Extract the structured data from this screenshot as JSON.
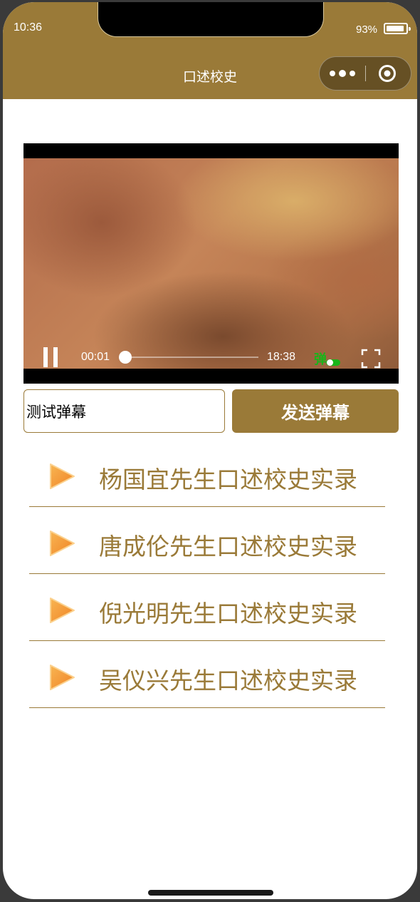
{
  "status_bar": {
    "time": "10:36",
    "battery_percent": "93%"
  },
  "nav": {
    "title": "口述校史",
    "capsule_icons": [
      "more-icon",
      "target-icon"
    ]
  },
  "video": {
    "current_time": "00:01",
    "total_time": "18:38",
    "progress": 0.0009,
    "danmu_toggle_label": "弹",
    "danmu_enabled": true,
    "paused": false
  },
  "danmu": {
    "input_value": "测试弹幕",
    "send_label": "发送弹幕"
  },
  "list": {
    "items": [
      {
        "label": "杨国宜先生口述校史实录"
      },
      {
        "label": "唐成伦先生口述校史实录"
      },
      {
        "label": "倪光明先生口述校史实录"
      },
      {
        "label": "吴仪兴先生口述校史实录"
      }
    ]
  },
  "colors": {
    "brand": "#9a7a38",
    "toggle_green": "#19b519",
    "play_icon": "#f39222"
  }
}
